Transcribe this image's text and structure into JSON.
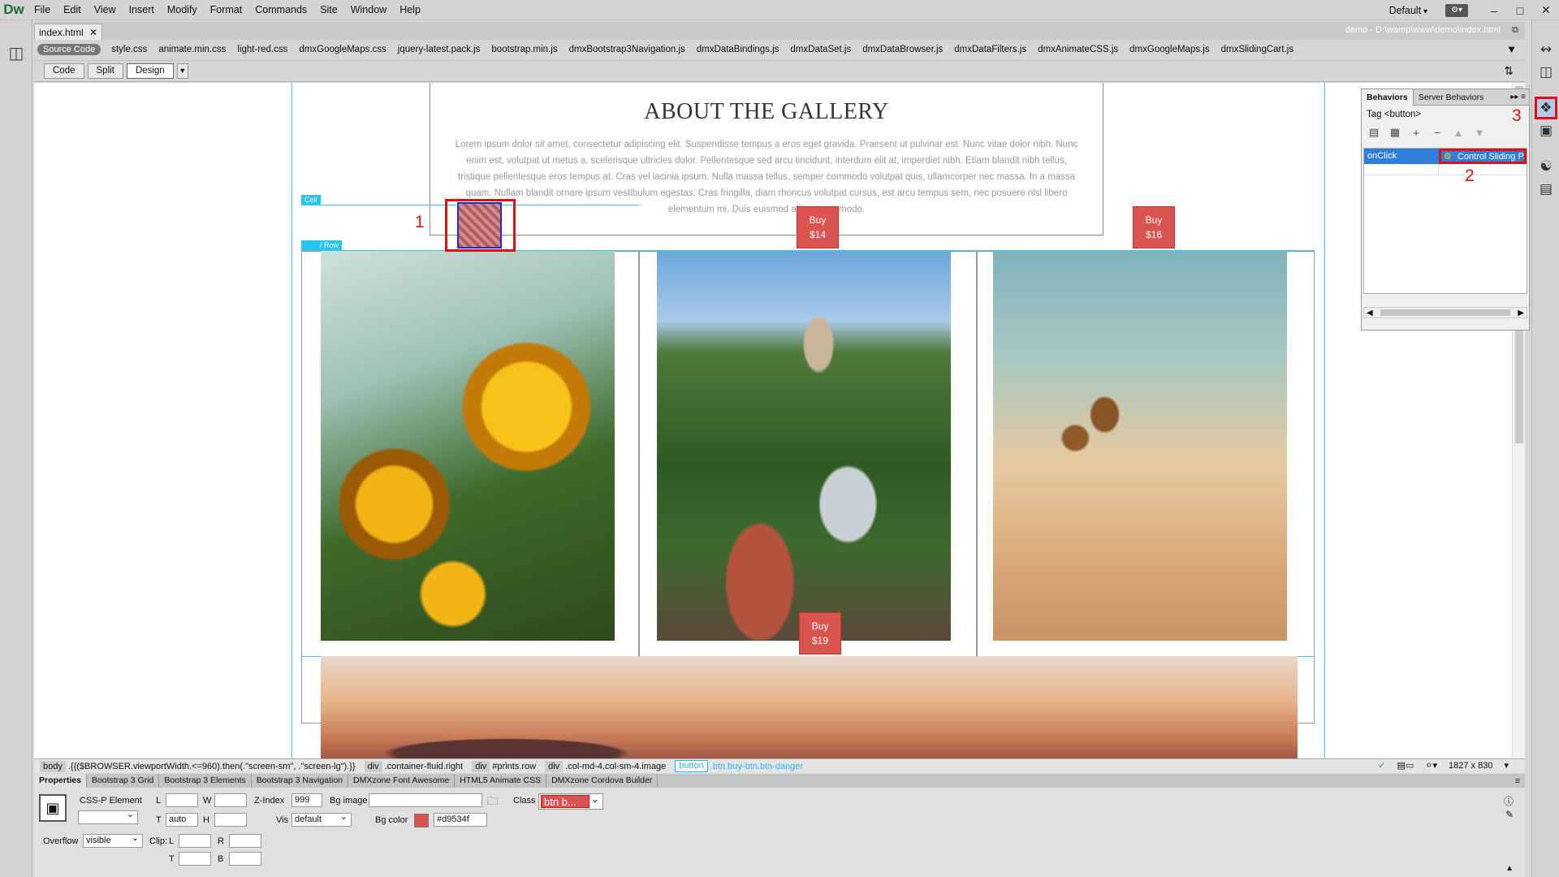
{
  "app": {
    "logo": "Dw",
    "menu": [
      "File",
      "Edit",
      "View",
      "Insert",
      "Modify",
      "Format",
      "Commands",
      "Site",
      "Window",
      "Help"
    ],
    "workspace": "Default",
    "window_controls": [
      "–",
      "□",
      "✕"
    ]
  },
  "document": {
    "tab_label": "index.html",
    "path": "demo - D:\\wamp\\www\\demo\\index.html"
  },
  "related_files": {
    "source_code": "Source Code",
    "files": [
      "style.css",
      "animate.min.css",
      "light-red.css",
      "dmxGoogleMaps.css",
      "jquery-latest.pack.js",
      "bootstrap.min.js",
      "dmxBootstrap3Navigation.js",
      "dmxDataBindings.js",
      "dmxDataSet.js",
      "dmxDataBrowser.js",
      "dmxDataFilters.js",
      "dmxAnimateCSS.js",
      "dmxGoogleMaps.js",
      "dmxSlidingCart.js"
    ]
  },
  "doc_toolbar": {
    "code": "Code",
    "split": "Split",
    "design": "Design"
  },
  "canvas": {
    "heading": "ABOUT THE GALLERY",
    "paragraph": "Lorem ipsum dolor sit amet, consectetur adipiscing elit. Suspendisse tempus a eros eget gravida. Praesent ut pulvinar est. Nunc vitae dolor nibh. Nunc enim est, volutpat ut metus a, scelerisque ultricies dolor. Pellentesque sed arcu tincidunt, interdum elit at, imperdiet nibh. Etiam blandit nibh tellus, tristique pellentesque eros tempus at. Cras vel lacinia ipsum. Nulla massa tellus, semper commodo volutpat quis, ullamcorper nec massa. In a massa quam. Nullam blandit ornare ipsum vestibulum egestas. Cras fringilla, diam rhoncus volutpat cursus, est arcu tempus sem, nec posuere nisl libero elementum mi. Duis euismod aliquet commodo.",
    "cell_label": "Cell",
    "row_label": "/ Row",
    "buy_buttons": [
      {
        "label": "Buy",
        "price": "$14"
      },
      {
        "label": "Buy",
        "price": "$16"
      },
      {
        "label": "Buy",
        "price": "$19"
      }
    ],
    "annotations": [
      "1",
      "2",
      "3"
    ]
  },
  "behaviors_panel": {
    "tabs": [
      "Behaviors",
      "Server Behaviors"
    ],
    "tag": "Tag <button>",
    "event": "onClick",
    "action": "Control Sliding P..."
  },
  "tag_selector": {
    "chips": [
      {
        "tag": "body",
        "detail": ".{{($BROWSER.viewportWidth.<=960).then(.\"screen-sm\", .\"screen-lg\").}}"
      },
      {
        "tag": "div",
        "detail": ".container-fluid.right"
      },
      {
        "tag": "div",
        "detail": "#prints.row"
      },
      {
        "tag": "div",
        "detail": ".col-md-4.col-sm-4.image"
      }
    ],
    "active_tag": "button",
    "active_detail": ".btn.buy-btn.btn-danger",
    "size": "1827 x 830"
  },
  "properties": {
    "tabs": [
      "Properties",
      "Bootstrap 3 Grid",
      "Bootstrap 3 Elements",
      "Bootstrap 3 Navigation",
      "DMXzone Font Awesome",
      "HTML5 Animate CSS",
      "DMXzone Cordova Builder"
    ],
    "element_type": "CSS-P Element",
    "l_label": "L",
    "l_value": "",
    "w_label": "W",
    "w_value": "",
    "zindex_label": "Z-Index",
    "zindex_value": "999",
    "bgimage_label": "Bg image",
    "bgimage_value": "",
    "class_label": "Class",
    "class_value": "btn b...",
    "t_label": "T",
    "t_value": "auto",
    "h_label": "H",
    "h_value": "",
    "vis_label": "Vis",
    "vis_value": "default",
    "bgcolor_label": "Bg color",
    "bgcolor_value": "#d9534f",
    "overflow_label": "Overflow",
    "overflow_value": "visible",
    "clip_label": "Clip:",
    "clip_l": "L",
    "clip_r": "R",
    "clip_t": "T",
    "clip_b": "B"
  },
  "colors": {
    "accent_red": "#d9534f",
    "annotation_red": "#e01010",
    "guide_cyan": "#33c9e8",
    "selection_blue": "#2f7fd8"
  }
}
